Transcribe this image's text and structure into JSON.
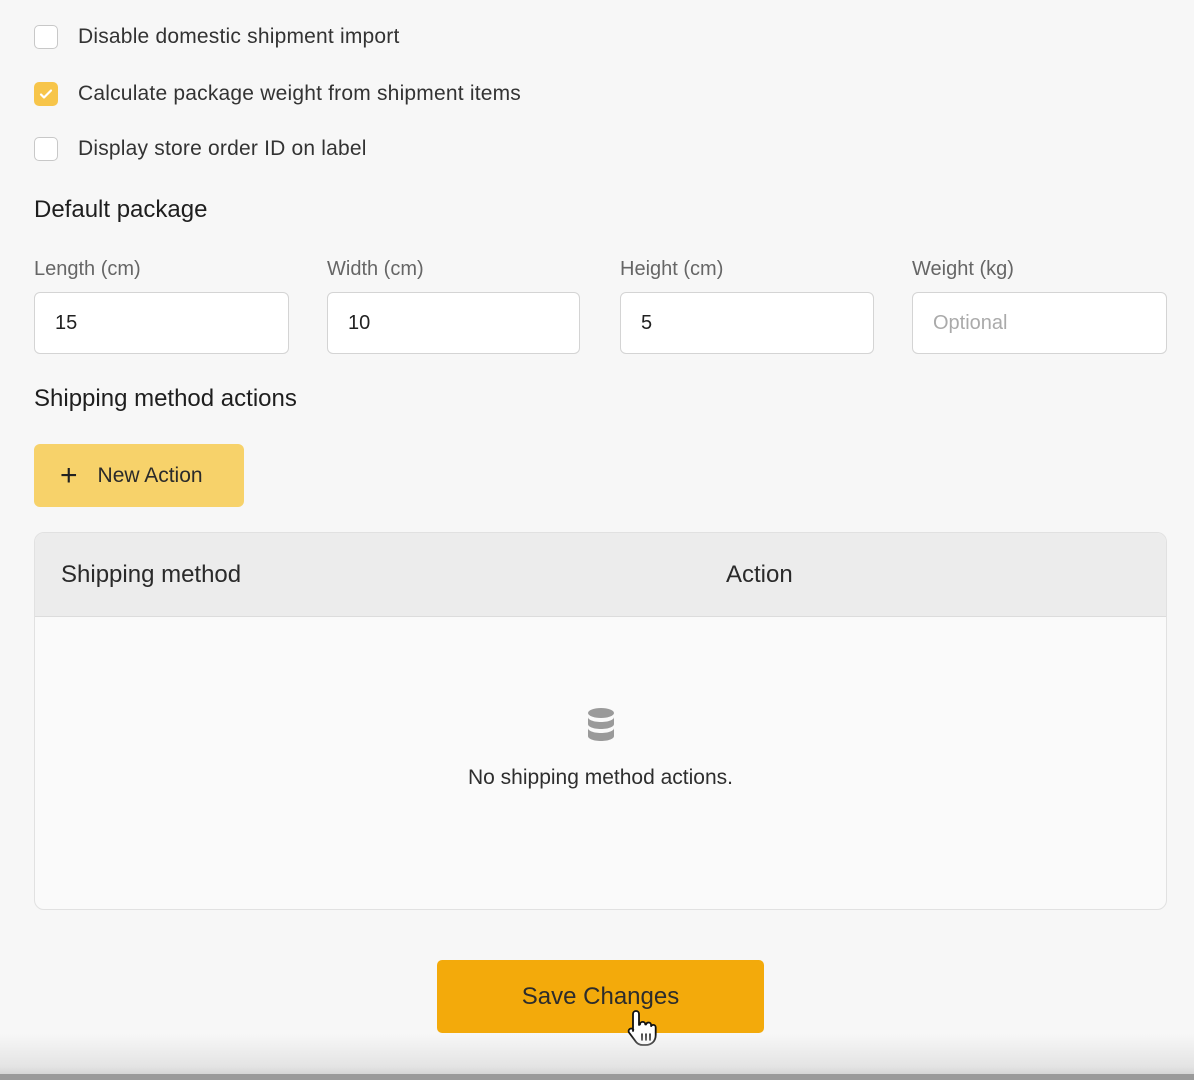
{
  "settings": {
    "checkboxes": [
      {
        "label": "Disable domestic shipment import",
        "checked": false
      },
      {
        "label": "Calculate package weight from shipment items",
        "checked": true
      },
      {
        "label": "Display store order ID on label",
        "checked": false
      }
    ]
  },
  "default_package": {
    "title": "Default package",
    "fields": {
      "length": {
        "label": "Length (cm)",
        "value": "15",
        "placeholder": ""
      },
      "width": {
        "label": "Width (cm)",
        "value": "10",
        "placeholder": ""
      },
      "height": {
        "label": "Height (cm)",
        "value": "5",
        "placeholder": ""
      },
      "weight": {
        "label": "Weight (kg)",
        "value": "",
        "placeholder": "Optional"
      }
    }
  },
  "shipping_actions": {
    "title": "Shipping method actions",
    "new_action_label": "New Action",
    "table": {
      "columns": [
        "Shipping method",
        "Action"
      ],
      "empty_text": "No shipping method actions.",
      "empty_icon": "database-icon"
    }
  },
  "footer": {
    "save_label": "Save Changes"
  },
  "colors": {
    "accent_light": "#f7d26a",
    "accent": "#f3aa0b",
    "checked": "#f7c54a"
  }
}
